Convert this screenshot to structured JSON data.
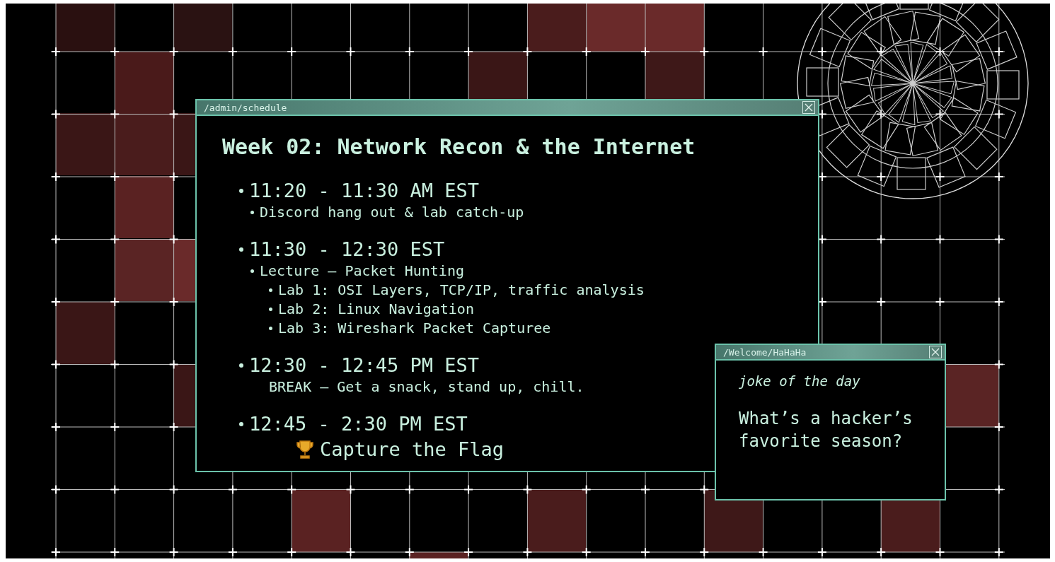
{
  "windows": [
    {
      "kind": "schedule",
      "title": "/admin/schedule",
      "heading": "Week 02: Network Recon & the Internet",
      "sessions": [
        {
          "time": "11:20 - 11:30 AM EST",
          "items": [
            {
              "kind": "bullet",
              "text": "Discord hang out & lab catch-up"
            }
          ]
        },
        {
          "time": "11:30 - 12:30 EST",
          "items": [
            {
              "kind": "bullet",
              "text": "Lecture – Packet Hunting",
              "children": [
                {
                  "kind": "bullet",
                  "text": "Lab 1: OSI Layers, TCP/IP, traffic analysis"
                },
                {
                  "kind": "bullet",
                  "text": "Lab 2: Linux Navigation"
                },
                {
                  "kind": "bullet",
                  "text": "Lab 3: Wireshark Packet Capturee"
                }
              ]
            }
          ]
        },
        {
          "time": "12:30 - 12:45 PM EST",
          "items": [
            {
              "kind": "plain",
              "text": "BREAK – Get a snack, stand up, chill."
            }
          ]
        },
        {
          "time": "12:45 - 2:30 PM EST",
          "items": [
            {
              "kind": "trophy",
              "text": "Capture the Flag"
            }
          ]
        }
      ]
    },
    {
      "kind": "joke",
      "title": "/Welcome/HaHaHa",
      "label": "joke of the day",
      "question": "What’s a hacker’s favorite season?"
    }
  ]
}
